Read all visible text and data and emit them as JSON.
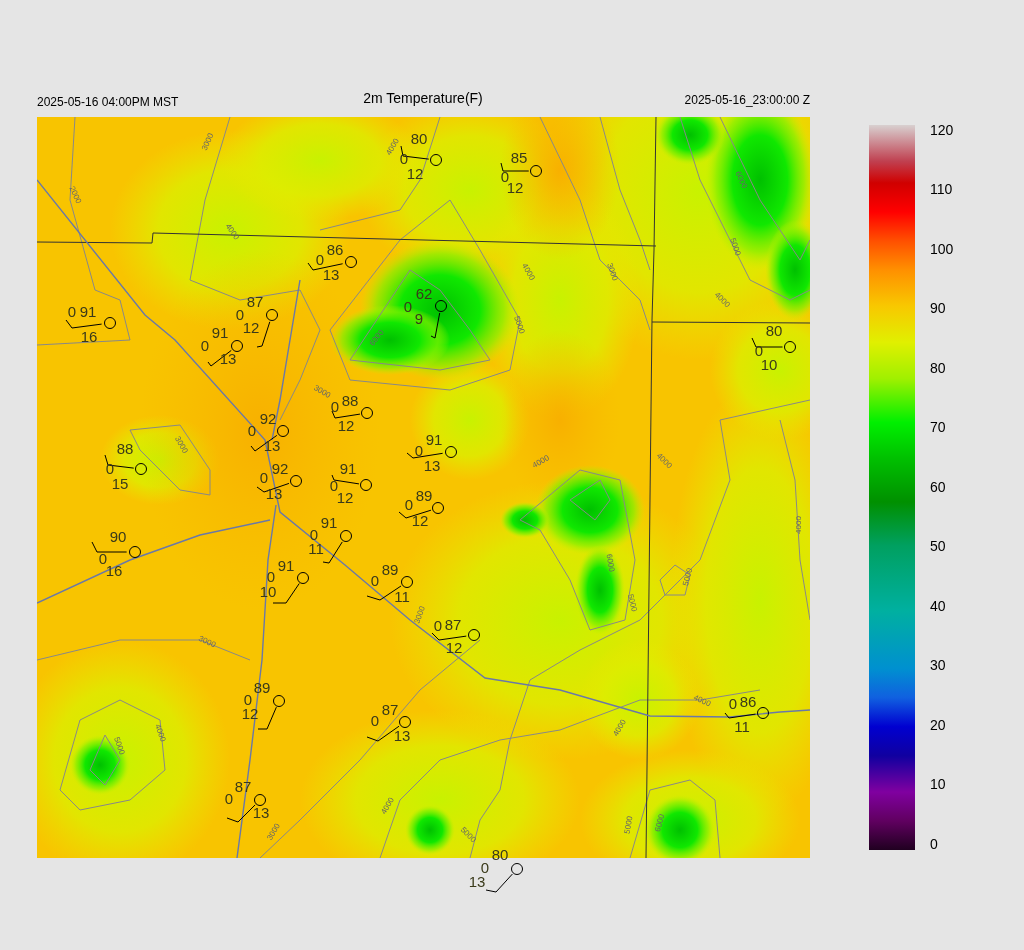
{
  "header": {
    "left": "2025-05-16 04:00PM MST",
    "title": "2m Temperature(F)",
    "right": "2025-05-16_23:00:00 Z"
  },
  "stations": [
    {
      "temperature": "80",
      "dewpoint": "0",
      "wind_speed": "12"
    },
    {
      "temperature": "85",
      "dewpoint": "0",
      "wind_speed": "12"
    },
    {
      "temperature": "86",
      "dewpoint": "0",
      "wind_speed": "13"
    },
    {
      "temperature": "91",
      "dewpoint": "0",
      "wind_speed": "16"
    },
    {
      "temperature": "87",
      "dewpoint": "0",
      "wind_speed": "12"
    },
    {
      "temperature": "91",
      "dewpoint": "0",
      "wind_speed": "13"
    },
    {
      "temperature": "62",
      "dewpoint": "0",
      "wind_speed": "9"
    },
    {
      "temperature": "80",
      "dewpoint": "0",
      "wind_speed": "10"
    },
    {
      "temperature": "88",
      "dewpoint": "0",
      "wind_speed": "12"
    },
    {
      "temperature": "92",
      "dewpoint": "0",
      "wind_speed": "13"
    },
    {
      "temperature": "91",
      "dewpoint": "0",
      "wind_speed": "13"
    },
    {
      "temperature": "88",
      "dewpoint": "0",
      "wind_speed": "15"
    },
    {
      "temperature": "92",
      "dewpoint": "0",
      "wind_speed": "13"
    },
    {
      "temperature": "91",
      "dewpoint": "0",
      "wind_speed": "12"
    },
    {
      "temperature": "89",
      "dewpoint": "0",
      "wind_speed": "12"
    },
    {
      "temperature": "91",
      "dewpoint": "0",
      "wind_speed": "11"
    },
    {
      "temperature": "90",
      "dewpoint": "0",
      "wind_speed": "16"
    },
    {
      "temperature": "91",
      "dewpoint": "0",
      "wind_speed": "10"
    },
    {
      "temperature": "89",
      "dewpoint": "0",
      "wind_speed": "11"
    },
    {
      "temperature": "87",
      "dewpoint": "0",
      "wind_speed": "12"
    },
    {
      "temperature": "86",
      "dewpoint": "0",
      "wind_speed": "11"
    },
    {
      "temperature": "89",
      "dewpoint": "0",
      "wind_speed": "12"
    },
    {
      "temperature": "87",
      "dewpoint": "0",
      "wind_speed": "13"
    },
    {
      "temperature": "87",
      "dewpoint": "0",
      "wind_speed": "13"
    },
    {
      "temperature": "80",
      "dewpoint": "0",
      "wind_speed": "13"
    }
  ],
  "contour_labels": [
    "3000",
    "2000",
    "4000",
    "4000",
    "4000",
    "3000",
    "5000",
    "6000",
    "3000",
    "3000",
    "4000",
    "4000",
    "6000",
    "5000",
    "4000",
    "4000",
    "5000",
    "6000",
    "5000",
    "3000",
    "3000",
    "4000",
    "5000",
    "4000",
    "3000",
    "5000",
    "4000",
    "4000",
    "5000",
    "6000"
  ],
  "colorbar": {
    "ticks": [
      "120",
      "110",
      "100",
      "90",
      "80",
      "70",
      "60",
      "50",
      "40",
      "30",
      "20",
      "10",
      "0"
    ]
  }
}
